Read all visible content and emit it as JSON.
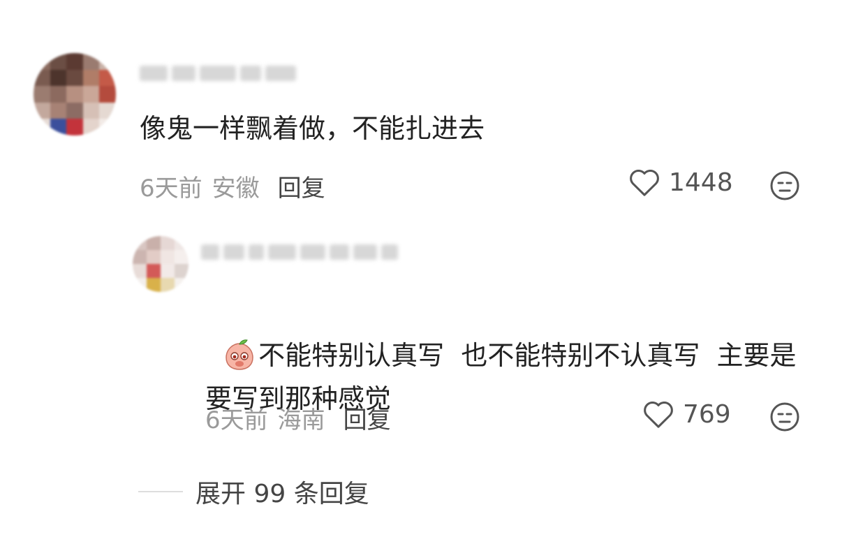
{
  "comments": [
    {
      "text": "像鬼一样飘着做，不能扎进去",
      "time": "6天前",
      "location": "安徽",
      "reply_label": "回复",
      "likes": "1448"
    }
  ],
  "reply": {
    "emoji": "peach-face-emoji",
    "text": "不能特别认真写  也不能特别不认真写  主要是要写到那种感觉",
    "time": "6天前",
    "location": "海南",
    "reply_label": "回复",
    "likes": "769"
  },
  "expand_label": "展开 99 条回复",
  "icons": {
    "like": "heart-outline-icon",
    "dislike": "meh-face-icon"
  },
  "colors": {
    "meta_gray": "#9a9a9a",
    "text_dark": "#222222"
  }
}
